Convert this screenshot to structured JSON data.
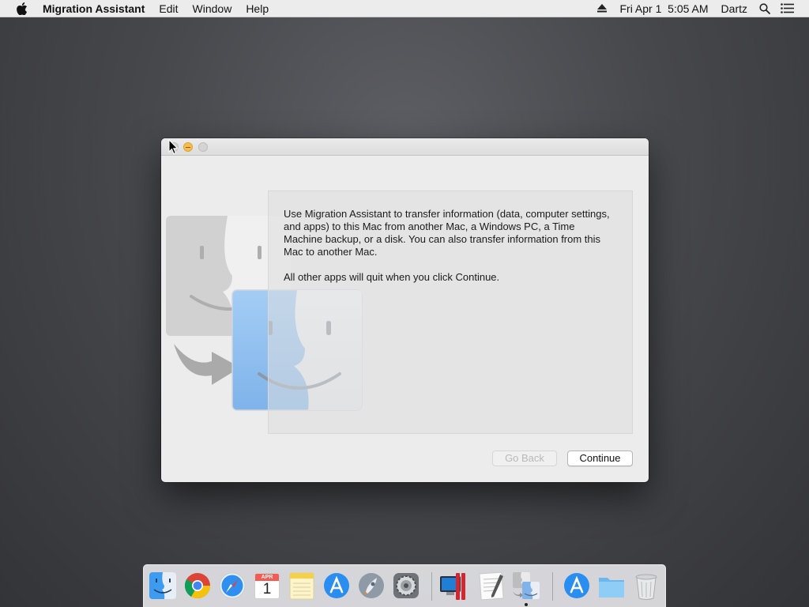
{
  "menubar": {
    "app_name": "Migration Assistant",
    "menus": [
      "Edit",
      "Window",
      "Help"
    ],
    "status": {
      "date": "Fri Apr 1",
      "time": "5:05 AM",
      "user": "Dartz"
    },
    "icons": [
      "apple-icon",
      "eject-icon",
      "spotlight-icon",
      "notification-center-icon"
    ]
  },
  "window": {
    "description_1": "Use Migration Assistant to transfer information (data, computer settings, and apps) to this Mac from another Mac, a Windows PC, a Time Machine backup, or a disk. You can also transfer information from this Mac to another Mac.",
    "description_2": "All other apps will quit when you click Continue.",
    "buttons": {
      "go_back": "Go Back",
      "continue": "Continue"
    }
  },
  "dock": {
    "calendar": {
      "month": "APR",
      "day": "1"
    },
    "items": [
      "Finder",
      "Chrome",
      "Safari",
      "Calendar",
      "Notes",
      "App Store",
      "Launchpad",
      "System Preferences",
      "Parallels",
      "TextEdit",
      "Migration Assistant",
      "App Store",
      "Downloads",
      "Trash"
    ]
  },
  "colors": {
    "accent": "#3a8ef0",
    "minimize": "#f5bd4f"
  }
}
